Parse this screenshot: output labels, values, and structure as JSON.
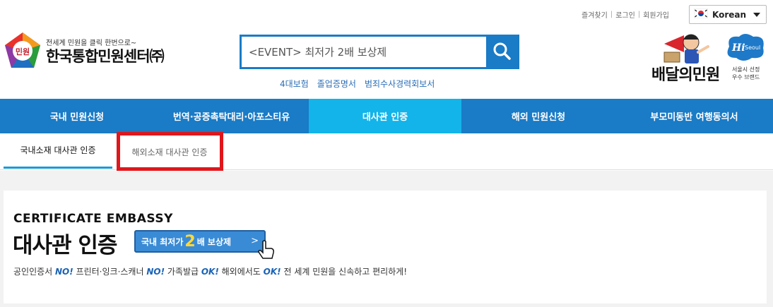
{
  "util": {
    "links": [
      "즐겨찾기",
      "로그인",
      "회원가입"
    ],
    "language": "Korean"
  },
  "logo": {
    "badge": "민원",
    "tagline": "전세계 민원을 클릭 한번으로~",
    "name": "한국통합민원센터㈜"
  },
  "search": {
    "value": "<EVENT> 최저가 2배 보상제",
    "keywords": [
      "4대보험",
      "졸업증명서",
      "범죄수사경력회보서"
    ]
  },
  "promo": {
    "title": "배달의민원",
    "hi": "Hi",
    "seoul": "Seoul",
    "subtitle": "서울시 선정\n우수 브랜드"
  },
  "nav": [
    "국내 민원신청",
    "번역·공증촉탁대리·아포스티유",
    "대사관 인증",
    "해외 민원신청",
    "부모미동반 여행동의서"
  ],
  "subtabs": [
    "국내소재 대사관 인증",
    "해외소재 대사관 인증"
  ],
  "content": {
    "title_en": "CERTIFICATE EMBASSY",
    "title_ko": "대사관 인증",
    "banner_pre": "국내 최저가",
    "banner_big": "2",
    "banner_post": "배 보상제",
    "banner_arrow": ">",
    "tagline": [
      {
        "t": "공인인증서 ",
        "k": "n"
      },
      {
        "t": "NO!",
        "k": "b"
      },
      {
        "t": " 프린터·잉크·스캐너 ",
        "k": "n"
      },
      {
        "t": "NO!",
        "k": "b"
      },
      {
        "t": " 가족발급 ",
        "k": "n"
      },
      {
        "t": "OK!",
        "k": "b"
      },
      {
        "t": " 해외에서도 ",
        "k": "n"
      },
      {
        "t": "OK!",
        "k": "b"
      },
      {
        "t": " 전 세계 민원을 신속하고 편리하게!",
        "k": "n"
      }
    ]
  },
  "colors": {
    "brand_blue": "#1a7bc6",
    "active_tab": "#12b4ea",
    "highlight_red": "#e0161c"
  }
}
